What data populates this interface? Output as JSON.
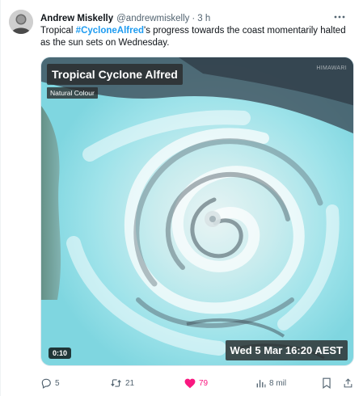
{
  "tweet": {
    "display_name": "Andrew Miskelly",
    "handle": "@andrewmiskelly",
    "separator": "·",
    "time": "3 h",
    "text_before": "Tropical ",
    "hashtag": "#CycloneAlfred",
    "text_after": "'s progress towards the coast momentarily halted as the sun sets on Wednesday."
  },
  "media": {
    "title": "Tropical Cyclone Alfred",
    "subtitle": "Natural Colour",
    "watermark": "HIMAWARI",
    "timestamp": "Wed 5 Mar 16:20 AEST",
    "duration": "0:10"
  },
  "actions": {
    "replies": "5",
    "reposts": "21",
    "likes": "79",
    "views": "8 mil"
  },
  "colors": {
    "hashtag": "#1d9bf0",
    "like": "#f91880",
    "muted": "#536471"
  },
  "icons": [
    "more-icon",
    "reply-icon",
    "repost-icon",
    "like-icon",
    "views-icon",
    "bookmark-icon",
    "share-icon"
  ]
}
